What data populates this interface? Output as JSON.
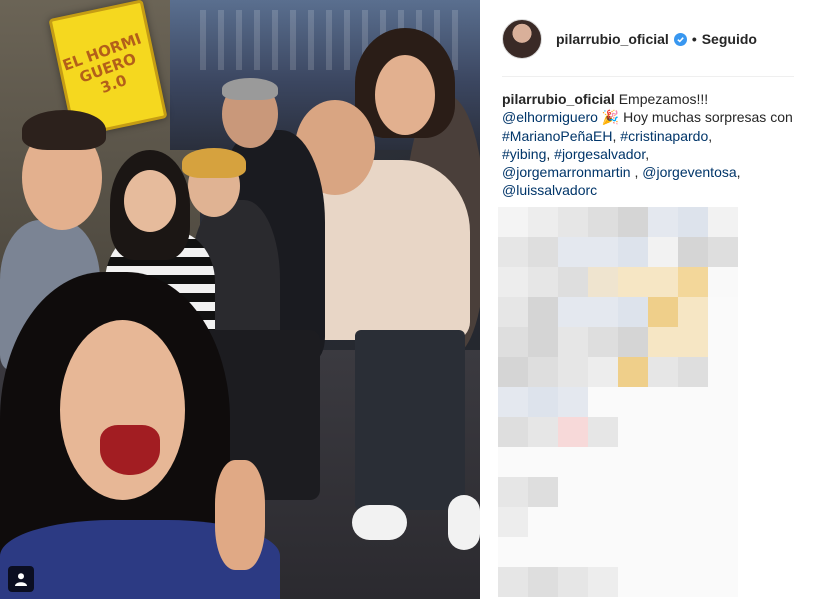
{
  "photo": {
    "sign_text_line1": "EL HORMI",
    "sign_text_line2": "GUERO 3.0",
    "badge_icon": "user-tag-icon"
  },
  "post": {
    "avatar_icon": "profile-avatar",
    "username": "pilarrubio_oficial",
    "verified_icon": "verified-badge-icon",
    "separator": "•",
    "follow_status": "Seguido",
    "caption": {
      "username": "pilarrubio_oficial",
      "intro": "Empezamos!!!",
      "mention_1": "@elhormiguero",
      "emoji": "🎉",
      "text_1": "Hoy muchas sorpresas con",
      "hashtag_1": "#MarianoPeñaEH",
      "sep_1": ",",
      "hashtag_2": "#cristinapardo",
      "sep_2": ",",
      "hashtag_3": "#yibing",
      "sep_3": ",",
      "hashtag_4": "#jorgesalvador",
      "sep_4": ",",
      "mention_2": "@jorgemarronmartin",
      "sep_5": ",",
      "mention_3": "@jorgeventosa",
      "sep_6": ",",
      "mention_4": "@luissalvadorc"
    }
  },
  "colors": {
    "link": "#003569",
    "verified": "#3897f0",
    "text": "#262626"
  }
}
